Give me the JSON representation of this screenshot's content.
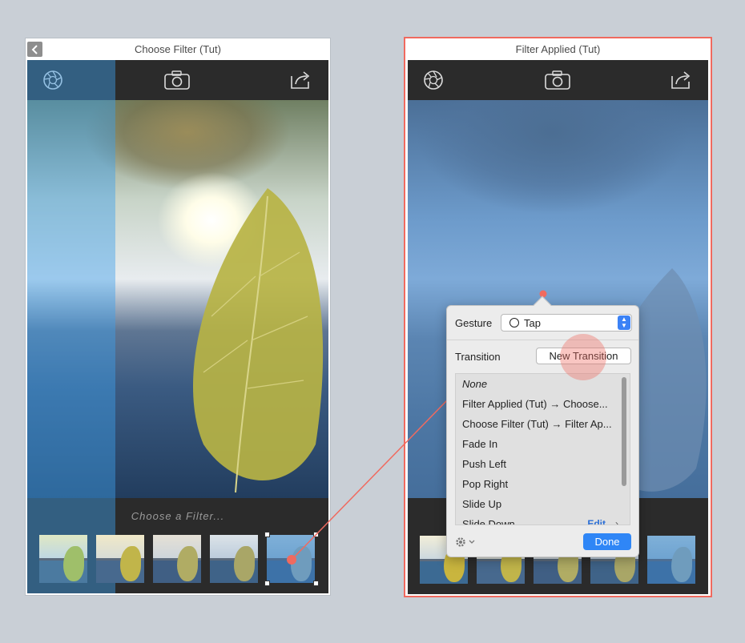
{
  "left_artboard": {
    "title": "Choose Filter (Tut)",
    "caption": "Choose a Filter...",
    "thumb_count": 5
  },
  "right_artboard": {
    "title": "Filter Applied (Tut)"
  },
  "popover": {
    "gesture_label": "Gesture",
    "gesture_value": "Tap",
    "transition_label": "Transition",
    "new_transition_button": "New Transition",
    "transitions": [
      "None",
      "Filter Applied (Tut) → Choose...",
      "Choose Filter (Tut) → Filter Ap...",
      "Fade In",
      "Push Left",
      "Pop Right",
      "Slide Up",
      "Slide Down"
    ],
    "edit_label": "Edit",
    "done_button": "Done"
  },
  "colors": {
    "link_accent": "#f06a5f",
    "button_blue": "#2f86f6",
    "toolbar_bg": "#2b2b2b",
    "canvas_bg": "#c9cfd6"
  },
  "icons": {
    "toolbar": [
      "aperture-icon",
      "camera-icon",
      "share-icon"
    ],
    "back": "chevron-left-icon",
    "gear": "gear-icon"
  }
}
